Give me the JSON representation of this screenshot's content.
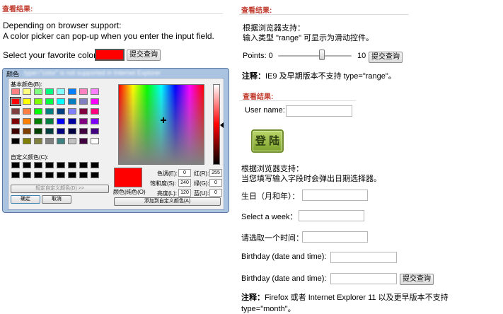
{
  "left": {
    "result_title": "查看结果:",
    "support_line1": "Depending on browser support:",
    "support_line2": "A color picker can pop-up when you enter the input field.",
    "color_label": "Select your favorite color:",
    "color_value": "#ff0000",
    "submit_label": "提交查询"
  },
  "dialog": {
    "title": "颜色",
    "blurred_text": "type=\"color\" is not supported in Internet Explorer",
    "basic_colors_label": "基本颜色(B):",
    "custom_colors_label": "自定义颜色(C):",
    "define_custom_label": "规定自定义颜色(D) >>",
    "ok_label": "确定",
    "cancel_label": "取消",
    "add_custom_label": "添加到自定义颜色(A)",
    "preview_label": "颜色|纯色(O)",
    "hue_label": "色调(E):",
    "hue_value": "0",
    "sat_label": "饱和度(S):",
    "sat_value": "240",
    "lum_label": "亮度(L):",
    "lum_value": "120",
    "red_label": "红(R):",
    "red_value": "255",
    "green_label": "绿(G):",
    "green_value": "0",
    "blue_label": "蓝(U):",
    "blue_value": "0",
    "selected_color": "#ff0000",
    "basic_colors": [
      "#ff8080",
      "#ffff80",
      "#80ff80",
      "#00ff80",
      "#80ffff",
      "#0080ff",
      "#ff80c0",
      "#ff80ff",
      "#ff0000",
      "#ffff00",
      "#80ff00",
      "#00ff40",
      "#00ffff",
      "#0080c0",
      "#8080c0",
      "#ff00ff",
      "#804040",
      "#ff8040",
      "#00ff00",
      "#008080",
      "#004080",
      "#8080ff",
      "#800040",
      "#ff0080",
      "#800000",
      "#ff8000",
      "#008000",
      "#008040",
      "#0000ff",
      "#0000a0",
      "#800080",
      "#8000ff",
      "#400000",
      "#804000",
      "#004000",
      "#004040",
      "#000080",
      "#000040",
      "#400040",
      "#400080",
      "#000000",
      "#808000",
      "#808040",
      "#808080",
      "#408080",
      "#c0c0c0",
      "#400040",
      "#ffffff"
    ]
  },
  "right": {
    "result_title_1": "查看结果:",
    "support_cn": "根据浏览器支持：",
    "range_note": "输入类型 \"range\" 可显示为滑动控件。",
    "points_label": "Points: 0",
    "points_max": "10",
    "range_value_fraction": 0.6,
    "submit_label": "提交查询",
    "note1_prefix": "注释：",
    "note1_text": "IE9 及早期版本不支持 type=\"range\"。",
    "result_title_2": "查看结果:",
    "username_label": "User name:",
    "login_label": "登 陆",
    "support_cn_2": "根据浏览器支持：",
    "date_note": "当您填写输入字段时会弹出日期选择器。",
    "birthday_month_label": "生日（月和年）：",
    "week_label": "Select a week：",
    "time_label": "请选取一个时间：",
    "bday_dt_label_1": "Birthday (date and time):",
    "bday_dt_label_2": "Birthday (date and time):",
    "submit_label_2": "提交查询",
    "note2_prefix": "注释：",
    "note2_text": "Firefox 或者 Internet Explorer 11 以及更早版本不支持 type=\"month\"。"
  }
}
